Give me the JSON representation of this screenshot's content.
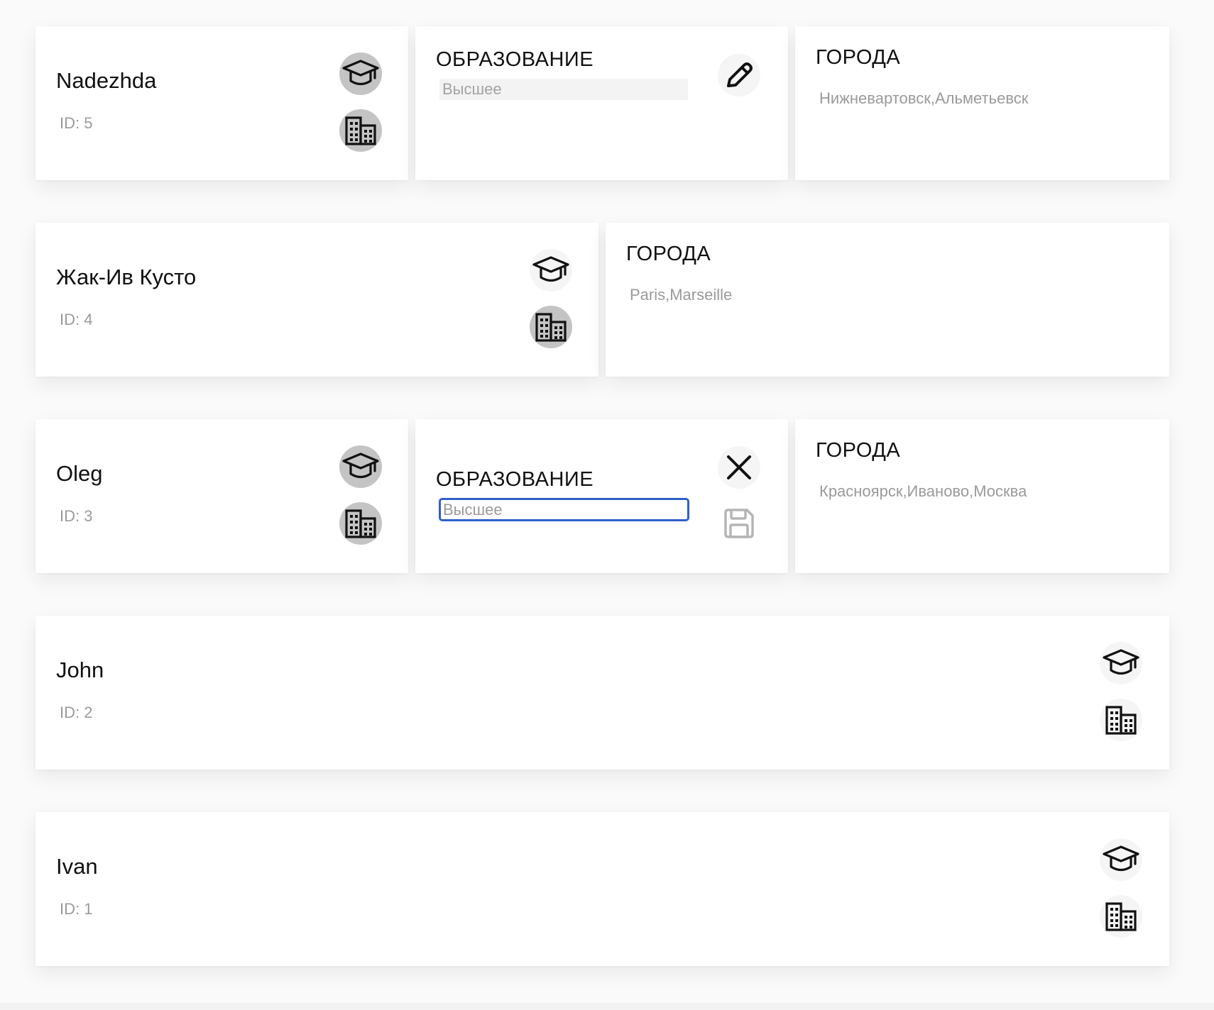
{
  "users": [
    {
      "name": "Nadezhda",
      "id_label": "ID: 5",
      "education": {
        "title": "ОБРАЗОВАНИЕ",
        "value": "Высшее",
        "mode": "view"
      },
      "cities": {
        "title": "ГОРОДА",
        "list": "Нижневартовск,Альметьевск"
      }
    },
    {
      "name": "Жак-Ив Кусто",
      "id_label": "ID: 4",
      "cities": {
        "title": "ГОРОДА",
        "list": "Paris,Marseille"
      }
    },
    {
      "name": "Oleg",
      "id_label": "ID: 3",
      "education": {
        "title": "ОБРАЗОВАНИЕ",
        "value": "Высшее",
        "mode": "edit"
      },
      "cities": {
        "title": "ГОРОДА",
        "list": "Красноярск,Иваново,Москва"
      }
    },
    {
      "name": "John",
      "id_label": "ID: 2"
    },
    {
      "name": "Ivan",
      "id_label": "ID: 1"
    }
  ],
  "icons": {
    "education": "graduation-cap-icon",
    "cities": "building-icon",
    "edit": "pencil-icon",
    "cancel": "close-icon",
    "save": "floppy-disk-icon"
  },
  "colors": {
    "input_focus_border": "#2f5fc7",
    "icon_active_bg": "#c4c4c4",
    "muted_text": "#9a9a9a"
  }
}
